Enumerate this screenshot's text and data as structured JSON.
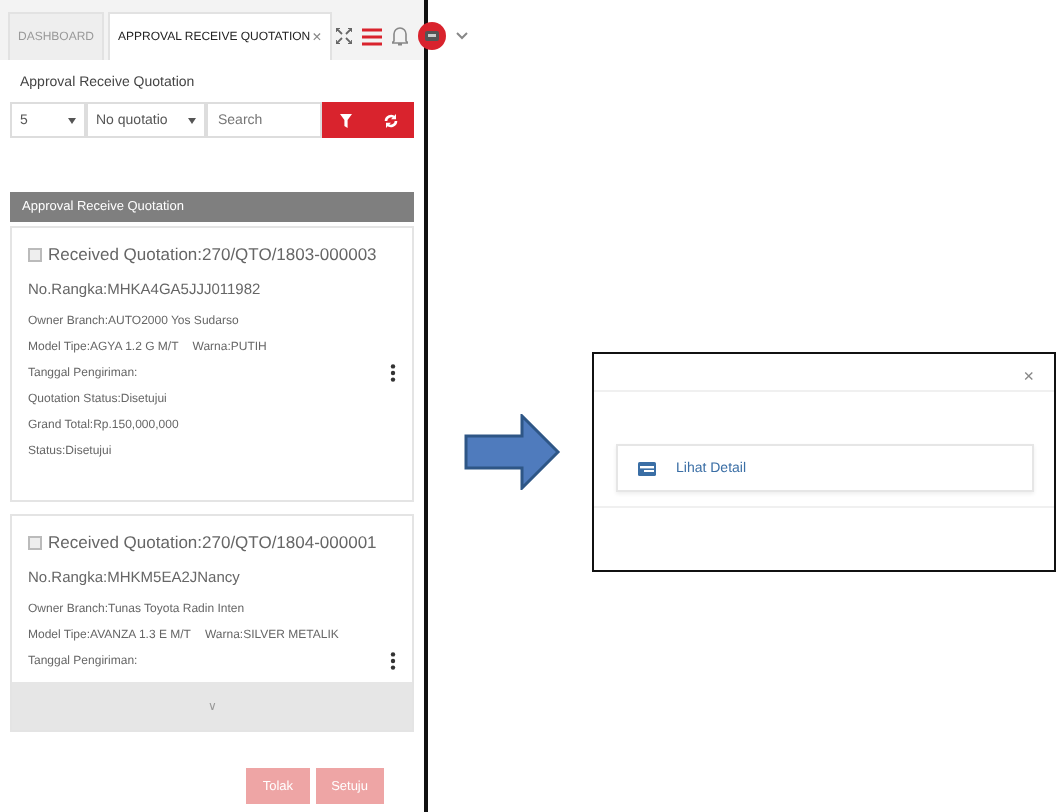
{
  "tabs": [
    {
      "label": "DASHBOARD",
      "selected": false
    },
    {
      "label": "APPROVAL RECEIVE QUOTATION",
      "selected": true,
      "close": "×"
    }
  ],
  "page_title": "Approval Receive Quotation",
  "filters": {
    "page_size": "5",
    "quotation": "No quotatio",
    "search": {
      "placeholder": "Search"
    }
  },
  "list_header": "Approval Receive Quotation",
  "cards": [
    {
      "checked": false,
      "title": "Received Quotation:270/QTO/1803-000003",
      "rangka": "No.Rangka:MHKA4GA5JJJ011982",
      "lines": [
        {
          "kind": "text",
          "parts": [
            "Owner Branch:AUTO2000 Yos Sudarso"
          ]
        },
        {
          "kind": "text",
          "parts": [
            "Model Tipe:AGYA 1.2 G M/T",
            "Warna:PUTIH"
          ]
        },
        {
          "kind": "menu",
          "parts": [
            "Tanggal Pengiriman:"
          ]
        },
        {
          "kind": "text",
          "parts": [
            "Quotation Status:Disetujui"
          ]
        },
        {
          "kind": "text",
          "parts": [
            "Grand Total:Rp.150,000,000"
          ]
        },
        {
          "kind": "text",
          "parts": [
            "Status:Disetujui"
          ]
        }
      ]
    },
    {
      "checked": false,
      "title": "Received Quotation:270/QTO/1804-000001",
      "rangka": "No.Rangka:MHKM5EA2JNancy",
      "lines": [
        {
          "kind": "text",
          "parts": [
            "Owner Branch:Tunas Toyota Radin Inten"
          ]
        },
        {
          "kind": "text",
          "parts": [
            "Model Tipe:AVANZA 1.3 E M/T",
            "Warna:SILVER METALIK"
          ]
        },
        {
          "kind": "menu",
          "parts": [
            "Tanggal Pengiriman:"
          ]
        }
      ],
      "more_label": "∨"
    }
  ],
  "buttons": [
    {
      "label": "Tolak",
      "disabled": true
    },
    {
      "label": "Setuju",
      "disabled": true
    }
  ],
  "modal": {
    "close": "×",
    "action": "Lihat Detail"
  }
}
